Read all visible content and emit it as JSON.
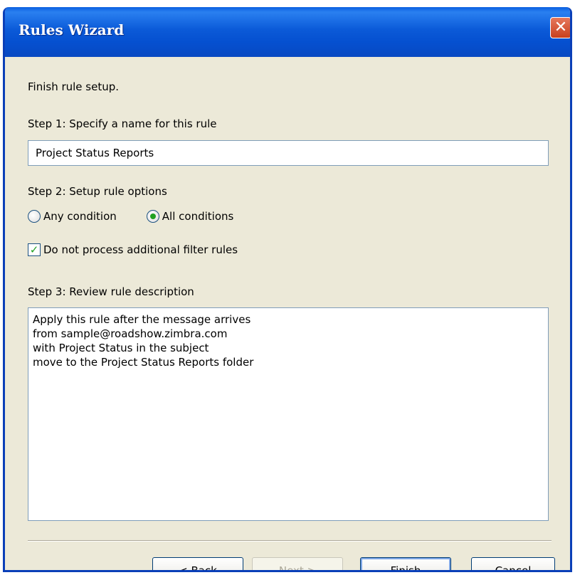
{
  "window": {
    "title": "Rules Wizard",
    "close_glyph": "✕"
  },
  "heading": "Finish rule setup.",
  "step1": {
    "label": "Step 1: Specify a name for this rule",
    "value": "Project Status Reports"
  },
  "step2": {
    "label": "Step 2: Setup rule options",
    "options": [
      {
        "label": "Any condition",
        "selected": false
      },
      {
        "label": "All conditions",
        "selected": true
      }
    ],
    "checkbox": {
      "label": "Do not process additional filter rules",
      "checked": true
    }
  },
  "step3": {
    "label": "Step 3: Review rule description",
    "lines": [
      "Apply this rule after the message arrives",
      "from sample@roadshow.zimbra.com",
      "with Project Status in the subject",
      "move to the Project Status Reports folder"
    ]
  },
  "buttons": {
    "back": "< Back",
    "next": "Next >",
    "finish": "Finish",
    "cancel": "Cancel"
  },
  "colors": {
    "title_bar": "#0550d0",
    "radio_selected": "#21a121",
    "dialog_bg": "#ece9d8"
  }
}
